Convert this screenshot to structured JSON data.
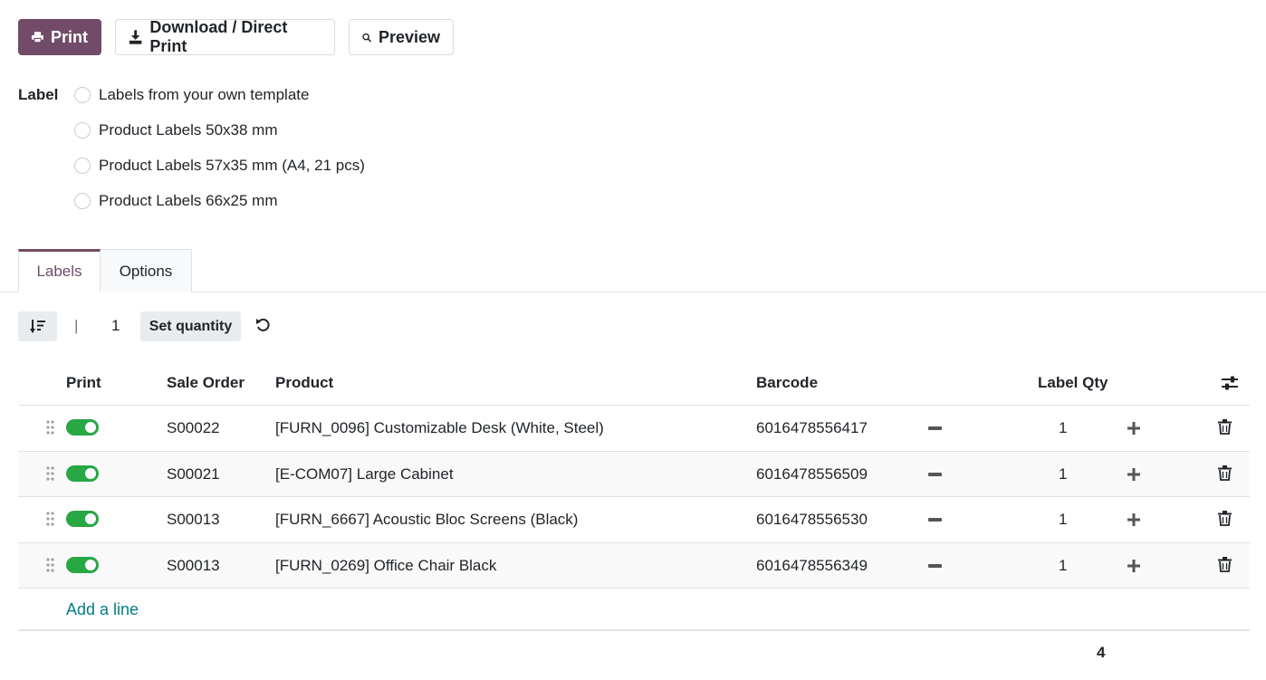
{
  "toolbar": {
    "print_label": "Print",
    "download_label": "Download / Direct Print",
    "preview_label": "Preview"
  },
  "label_section": {
    "title": "Label",
    "options": [
      "Labels from your own template",
      "Product Labels 50x38 mm",
      "Product Labels 57x35 mm (A4, 21 pcs)",
      "Product Labels 66x25 mm"
    ]
  },
  "tabs": [
    {
      "label": "Labels",
      "active": true
    },
    {
      "label": "Options",
      "active": false
    }
  ],
  "list_toolbar": {
    "separator": "|",
    "quantity": "1",
    "set_quantity_label": "Set quantity"
  },
  "table": {
    "headers": {
      "print": "Print",
      "sale_order": "Sale Order",
      "product": "Product",
      "barcode": "Barcode",
      "label_qty": "Label Qty"
    },
    "rows": [
      {
        "sale_order": "S00022",
        "product": "[FURN_0096] Customizable Desk (White, Steel)",
        "barcode": "6016478556417",
        "qty": "1",
        "print": true
      },
      {
        "sale_order": "S00021",
        "product": "[E-COM07] Large Cabinet",
        "barcode": "6016478556509",
        "qty": "1",
        "print": true
      },
      {
        "sale_order": "S00013",
        "product": "[FURN_6667] Acoustic Bloc Screens (Black)",
        "barcode": "6016478556530",
        "qty": "1",
        "print": true
      },
      {
        "sale_order": "S00013",
        "product": "[FURN_0269] Office Chair Black",
        "barcode": "6016478556349",
        "qty": "1",
        "print": true
      }
    ],
    "add_line_label": "Add a line",
    "total_qty": "4"
  },
  "colors": {
    "primary": "#714B67",
    "toggle_on": "#28a745",
    "link": "#017e84"
  }
}
